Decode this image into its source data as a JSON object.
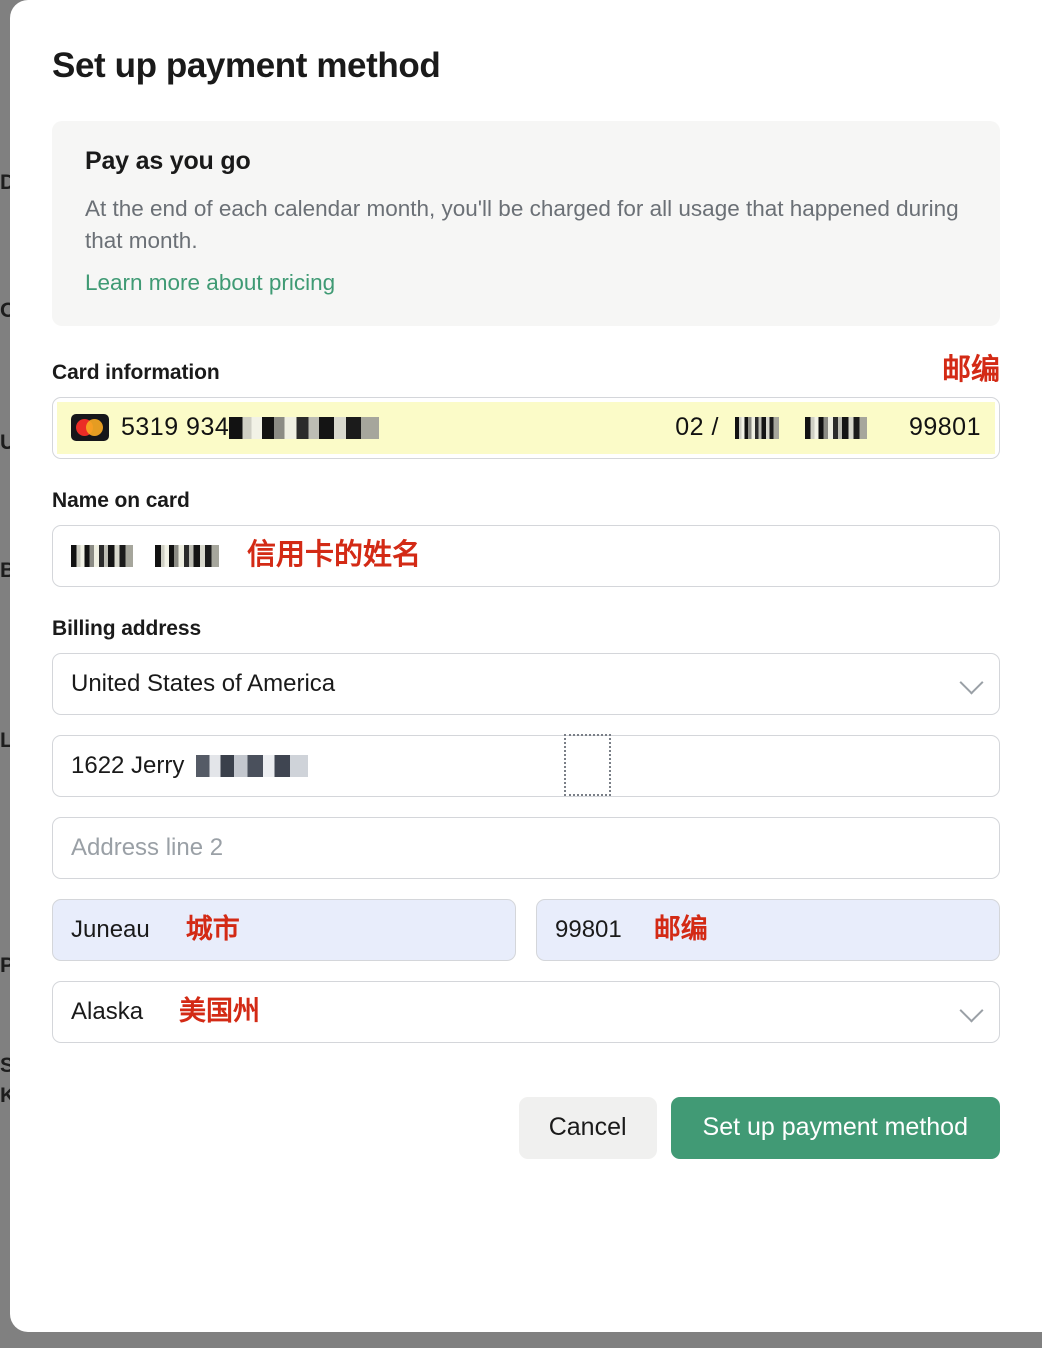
{
  "dialog": {
    "title": "Set up payment method"
  },
  "info_panel": {
    "title": "Pay as you go",
    "body": "At the end of each calendar month, you'll be charged for all usage that happened during that month.",
    "link": "Learn more about pricing",
    "link_color": "#3f9a74"
  },
  "card_section": {
    "label": "Card information",
    "annotation": "邮编",
    "brand_icon": "mastercard-icon",
    "number_visible": "5319 934",
    "number_redacted": true,
    "expiry_visible": "02 /",
    "expiry_redacted": true,
    "cvc_redacted": true,
    "zip": "99801",
    "autofill_color": "#fbfbc8"
  },
  "name_section": {
    "label": "Name on card",
    "value_redacted": true,
    "annotation": "信用卡的姓名"
  },
  "billing": {
    "label": "Billing address",
    "country": {
      "value": "United States of America",
      "icon": "chevron-down-icon"
    },
    "address_line1": {
      "value_visible": "1622 Jerry",
      "value_redacted": true
    },
    "address_line2": {
      "placeholder": "Address line 2"
    },
    "city": {
      "value": "Juneau",
      "annotation": "城市"
    },
    "postal_code": {
      "value": "99801",
      "annotation": "邮编"
    },
    "state": {
      "value": "Alaska",
      "annotation": "美国州",
      "icon": "chevron-down-icon"
    },
    "autofill_color": "#e8edfb"
  },
  "footer": {
    "cancel_label": "Cancel",
    "submit_label": "Set up payment method",
    "submit_color": "#419a75"
  },
  "annotation_color": "#d32a15"
}
